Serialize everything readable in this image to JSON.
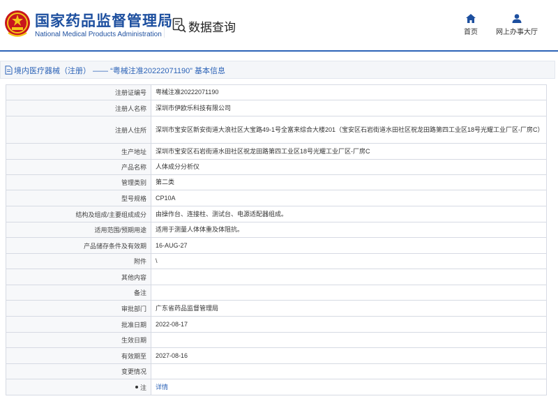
{
  "header": {
    "brand_cn": "国家药品监督管理局",
    "brand_en": "National Medical Products Administration",
    "query_label": "数据查询",
    "nav": [
      {
        "label": "首页",
        "icon": "home-icon"
      },
      {
        "label": "网上办事大厅",
        "icon": "user-icon"
      }
    ],
    "accent_color": "#2c63b7",
    "brand_color": "#1d4f9f"
  },
  "breadcrumb": {
    "text": "境内医疗器械（注册） —— “粤械注准20222071190” 基本信息"
  },
  "table": {
    "rows": [
      {
        "label": "注册证编号",
        "value": "粤械注准20222071190"
      },
      {
        "label": "注册人名称",
        "value": "深圳市伊欧乐科技有限公司"
      },
      {
        "label": "注册人住所",
        "value": "深圳市宝安区新安街道大浪社区大宝路49-1号全富来综合大楼201（宝安区石岩街道水田社区祝龙田路第四工业区18号光耀工业厂区-厂房C）"
      },
      {
        "label": "生产地址",
        "value": "深圳市宝安区石岩街道水田社区祝龙田路第四工业区18号光耀工业厂区-厂房C"
      },
      {
        "label": "产品名称",
        "value": "人体成分分析仪"
      },
      {
        "label": "管理类别",
        "value": "第二类"
      },
      {
        "label": "型号规格",
        "value": "CP10A"
      },
      {
        "label": "结构及组成/主要组成成分",
        "value": "由操作台、连接柱、测试台、电源适配器组成。"
      },
      {
        "label": "适用范围/预期用途",
        "value": "适用于测量人体体重及体阻抗。"
      },
      {
        "label": "产品储存条件及有效期",
        "value": "16-AUG-27"
      },
      {
        "label": "附件",
        "value": "\\"
      },
      {
        "label": "其他内容",
        "value": ""
      },
      {
        "label": "备注",
        "value": ""
      },
      {
        "label": "审批部门",
        "value": "广东省药品监督管理局"
      },
      {
        "label": "批准日期",
        "value": "2022-08-17"
      },
      {
        "label": "生效日期",
        "value": ""
      },
      {
        "label": "有效期至",
        "value": "2027-08-16"
      },
      {
        "label": "变更情况",
        "value": ""
      },
      {
        "label": "注",
        "value": "详情"
      }
    ]
  }
}
